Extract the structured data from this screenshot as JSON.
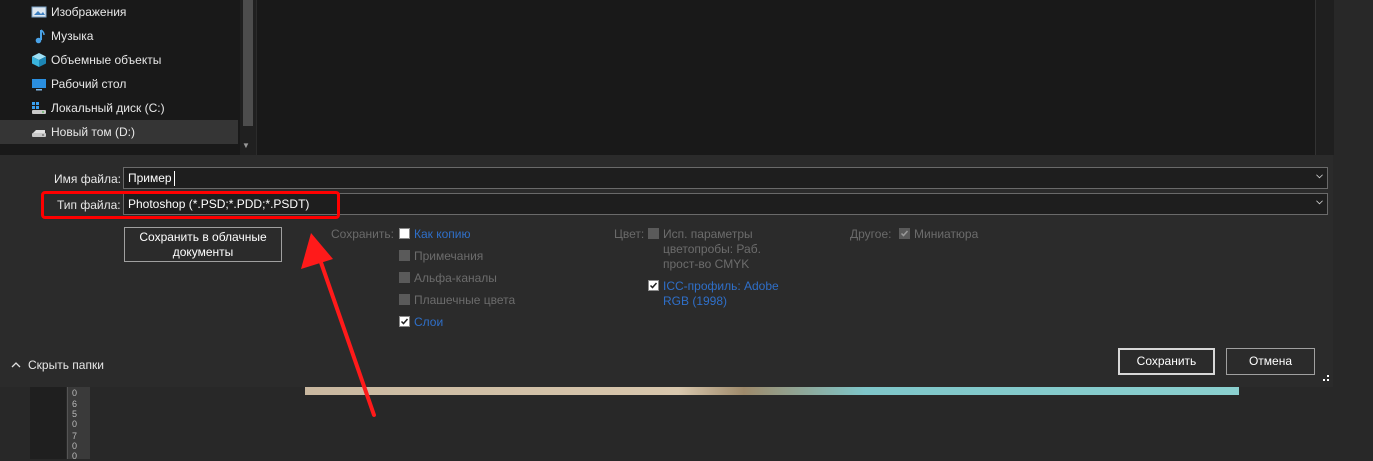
{
  "navigation": {
    "items": [
      {
        "label": "Изображения",
        "icon": "pictures-icon"
      },
      {
        "label": "Музыка",
        "icon": "music-icon"
      },
      {
        "label": "Объемные объекты",
        "icon": "3d-objects-icon"
      },
      {
        "label": "Рабочий стол",
        "icon": "desktop-icon"
      },
      {
        "label": "Локальный диск (C:)",
        "icon": "windows-drive-icon"
      },
      {
        "label": "Новый том (D:)",
        "icon": "drive-icon",
        "selected": true
      }
    ]
  },
  "form": {
    "filename_label": "Имя файла:",
    "filename_value": "Пример",
    "filetype_label": "Тип файла:",
    "filetype_value": "Photoshop (*.PSD;*.PDD;*.PSDT)"
  },
  "cloud_button": {
    "line1": "Сохранить в облачные",
    "line2": "документы"
  },
  "save_options": {
    "label": "Сохранить:",
    "items": [
      {
        "label": "Как копию",
        "checked": false
      },
      {
        "label": "Примечания",
        "checked": false
      },
      {
        "label": "Альфа-каналы",
        "checked": false
      },
      {
        "label": "Плашечные цвета",
        "checked": false
      },
      {
        "label": "Слои",
        "checked": true
      }
    ]
  },
  "color_options": {
    "label": "Цвет:",
    "proof": {
      "line1": "Исп. параметры",
      "line2": "цветопробы:  Раб.",
      "line3": "прост-во CMYK",
      "checked": false
    },
    "icc": {
      "line1": "ICC-профиль:  Adobe",
      "line2": "RGB (1998)",
      "checked": true
    }
  },
  "other_options": {
    "label": "Другое:",
    "thumbnail": "Миниатюра",
    "checked": true
  },
  "buttons": {
    "save": "Сохранить",
    "cancel": "Отмена"
  },
  "hide_folders": "Скрыть папки",
  "ruler": {
    "labels": [
      "0",
      "6",
      "5",
      "0",
      "7",
      "0",
      "0"
    ]
  },
  "colors": {
    "highlight": "#ff0000",
    "link_blue": "#2f6fc8",
    "dialog_bg": "#2b2b2b"
  }
}
